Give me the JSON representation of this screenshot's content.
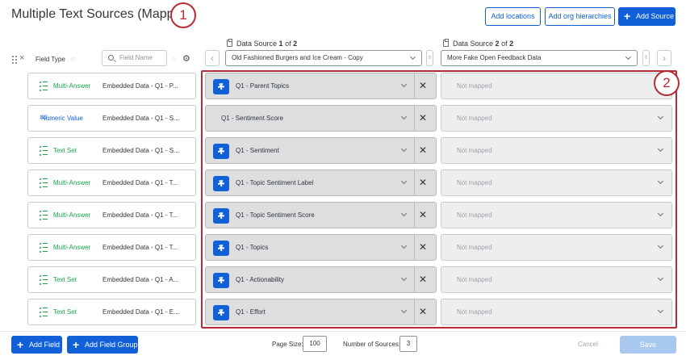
{
  "page_title": "Multiple Text Sources (Mapper)",
  "callouts": [
    "1",
    "2"
  ],
  "header_buttons": {
    "add_locations": "Add locations",
    "add_org_hierarchies": "Add org hierarchies",
    "add_source": "Add Source"
  },
  "columns": {
    "field_type": "Field Type",
    "field_name_placeholder": "Field Name"
  },
  "data_sources": [
    {
      "label_prefix": "Data Source",
      "index": "1",
      "of": "of",
      "total": "2",
      "selected": "Old Fashioned Burgers and Ice Cream - Copy"
    },
    {
      "label_prefix": "Data Source",
      "index": "2",
      "of": "of",
      "total": "2",
      "selected": "More Fake Open Feedback Data"
    }
  ],
  "rows": [
    {
      "field_type": "Multi-Answer",
      "embedded": "Embedded Data - Q1 - P...",
      "mapped": "Q1 - Parent Topics",
      "has_gear": true,
      "source2": "Not mapped"
    },
    {
      "field_type": "Numeric Value",
      "embedded": "Embedded Data - Q1 - S...",
      "mapped": "Q1 - Sentiment Score",
      "has_gear": false,
      "source2": "Not mapped"
    },
    {
      "field_type": "Text Set",
      "embedded": "Embedded Data - Q1 - S...",
      "mapped": "Q1 - Sentiment",
      "has_gear": true,
      "source2": "Not mapped"
    },
    {
      "field_type": "Multi-Answer",
      "embedded": "Embedded Data - Q1 - T...",
      "mapped": "Q1 - Topic Sentiment Label",
      "has_gear": true,
      "source2": "Not mapped"
    },
    {
      "field_type": "Multi-Answer",
      "embedded": "Embedded Data - Q1 - T...",
      "mapped": "Q1 - Topic Sentiment Score",
      "has_gear": true,
      "source2": "Not mapped"
    },
    {
      "field_type": "Multi-Answer",
      "embedded": "Embedded Data - Q1 - T...",
      "mapped": "Q1 - Topics",
      "has_gear": true,
      "source2": "Not mapped"
    },
    {
      "field_type": "Text Set",
      "embedded": "Embedded Data - Q1 - A...",
      "mapped": "Q1 - Actionability",
      "has_gear": true,
      "source2": "Not mapped"
    },
    {
      "field_type": "Text Set",
      "embedded": "Embedded Data - Q1 - E...",
      "mapped": "Q1 - Effort",
      "has_gear": true,
      "source2": "Not mapped"
    }
  ],
  "footer": {
    "add_field": "Add Field",
    "add_field_group": "Add Field Group",
    "page_size_label": "Page Size:",
    "page_size": "100",
    "num_sources_label": "Number of Sources:",
    "num_sources": "3",
    "cancel": "Cancel",
    "save": "Save"
  },
  "colors": {
    "accent": "#1160d8",
    "callout": "#b72b34",
    "field_type_green": "#16a34a"
  }
}
